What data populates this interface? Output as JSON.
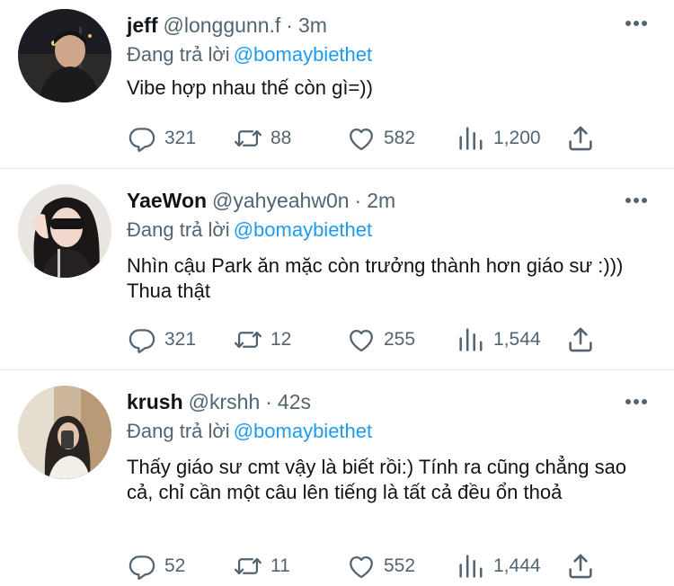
{
  "colors": {
    "accent": "#1d9bf0",
    "secondary_text": "#536471",
    "primary_text": "#0f1419",
    "divider": "#e6e8ea"
  },
  "replying_prefix": "Đang trả lời",
  "tweets": [
    {
      "name": "jeff",
      "handle": "@longgunn.f",
      "separator": "·",
      "time": "3m",
      "mention": "@bomaybiethet",
      "text": "Vibe hợp nhau thế còn gì=))",
      "replies": "321",
      "retweets": "88",
      "likes": "582",
      "views": "1,200"
    },
    {
      "name": "YaeWon",
      "handle": "@yahyeahw0n",
      "separator": "·",
      "time": "2m",
      "mention": "@bomaybiethet",
      "text": "Nhìn cậu Park  ăn mặc còn trưởng thành hơn giáo sư :))) Thua thật",
      "replies": "321",
      "retweets": "12",
      "likes": "255",
      "views": "1,544"
    },
    {
      "name": "krush",
      "handle": "@krshh",
      "separator": "·",
      "time": "42s",
      "mention": "@bomaybiethet",
      "text": "Thấy giáo sư cmt vậy là biết rồi:) Tính ra cũng chẳng sao cả, chỉ cần một câu lên tiếng là tất cả đều ổn thoả",
      "replies": "52",
      "retweets": "11",
      "likes": "552",
      "views": "1,444"
    }
  ],
  "icons": {
    "reply": "reply-icon",
    "retweet": "retweet-icon",
    "like": "heart-icon",
    "views": "views-icon",
    "share": "share-icon",
    "more": "more-icon"
  }
}
